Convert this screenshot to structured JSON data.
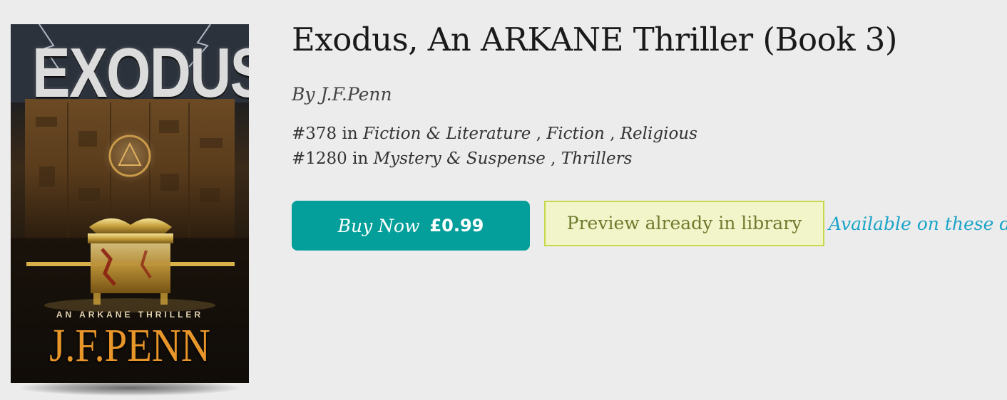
{
  "book": {
    "title": "Exodus, An ARKANE Thriller (Book 3)",
    "byline": "By J.F.Penn",
    "cover": {
      "title": "EXODUS",
      "series": "AN ARKANE THRILLER",
      "author": "J.F.PENN"
    }
  },
  "rankings": [
    {
      "rank": "#378",
      "in": "in",
      "categories": [
        "Fiction & Literature",
        "Fiction",
        "Religious"
      ]
    },
    {
      "rank": "#1280",
      "in": "in",
      "categories": [
        "Mystery & Suspense",
        "Thrillers"
      ]
    }
  ],
  "actions": {
    "buy_label": "Buy Now",
    "buy_price": "£0.99",
    "preview_status": "Preview already in library",
    "devices_link": "Available on these d"
  },
  "colors": {
    "background": "#ececec",
    "buy_button": "#049f9a",
    "preview_border": "#c8d84a",
    "preview_background": "#f1f5c9",
    "link": "#1aa4c8",
    "cover_author": "#e8962a"
  }
}
